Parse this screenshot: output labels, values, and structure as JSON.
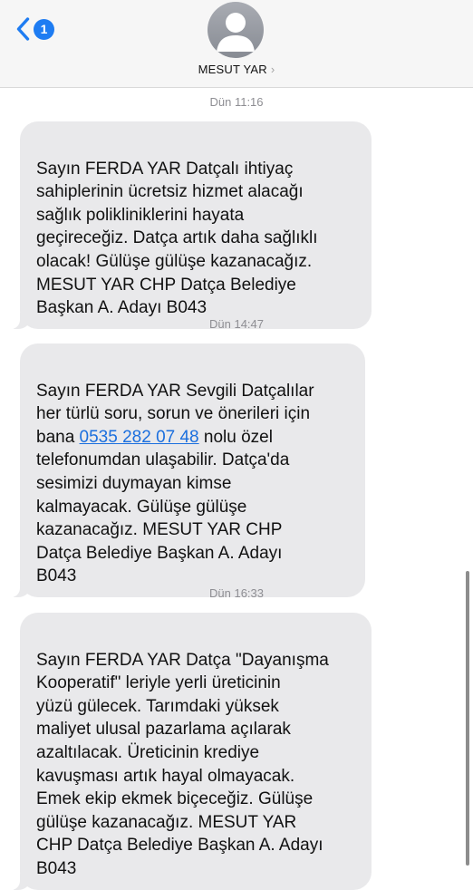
{
  "header": {
    "unread_count": "1",
    "contact_name": "MESUT YAR",
    "chevron": "›"
  },
  "messages": [
    {
      "timestamp": "Dün 11:16",
      "text": "Sayın FERDA YAR  Datçalı ihtiyaç\nsahiplerinin ücretsiz hizmet alacağı\nsağlık polikliniklerini hayata\ngeçireceğiz. Datça artık daha sağlıklı\nolacak! Gülüşe gülüşe kazanacağız.\nMESUT YAR CHP Datça Belediye\nBaşkan A. Adayı B043"
    },
    {
      "timestamp": "Dün 14:47",
      "text_before": "Sayın FERDA YAR  Sevgili Datçalılar\nher türlü soru, sorun ve önerileri için\nbana ",
      "phone_link": "0535 282 07 48",
      "text_after": " nolu özel\ntelefonumdan ulaşabilir. Datça'da\nsesimizi duymayan kimse\nkalmayacak. Gülüşe gülüşe\nkazanacağız. MESUT YAR CHP\nDatça Belediye Başkan A. Adayı\nB043"
    },
    {
      "timestamp": "Dün 16:33",
      "text": "Sayın FERDA YAR  Datça \"Dayanışma\nKooperatif\" leriyle yerli üreticinin\nyüzü gülecek. Tarımdaki yüksek\nmaliyet ulusal pazarlama açılarak\nazaltılacak. Üreticinin krediye\nkavuşması artık hayal olmayacak.\nEmek ekip ekmek biçeceğiz. Gülüşe\ngülüşe kazanacağız. MESUT YAR\nCHP Datça Belediye Başkan A. Adayı\nB043"
    }
  ],
  "icons": {
    "back": "chevron-left-icon",
    "avatar": "person-silhouette-icon"
  },
  "colors": {
    "accent": "#1e7cf2",
    "bubble": "#e9e9eb",
    "link": "#1b6fde",
    "timestamp": "#8e8e93",
    "header_bg": "#f6f6f6"
  }
}
